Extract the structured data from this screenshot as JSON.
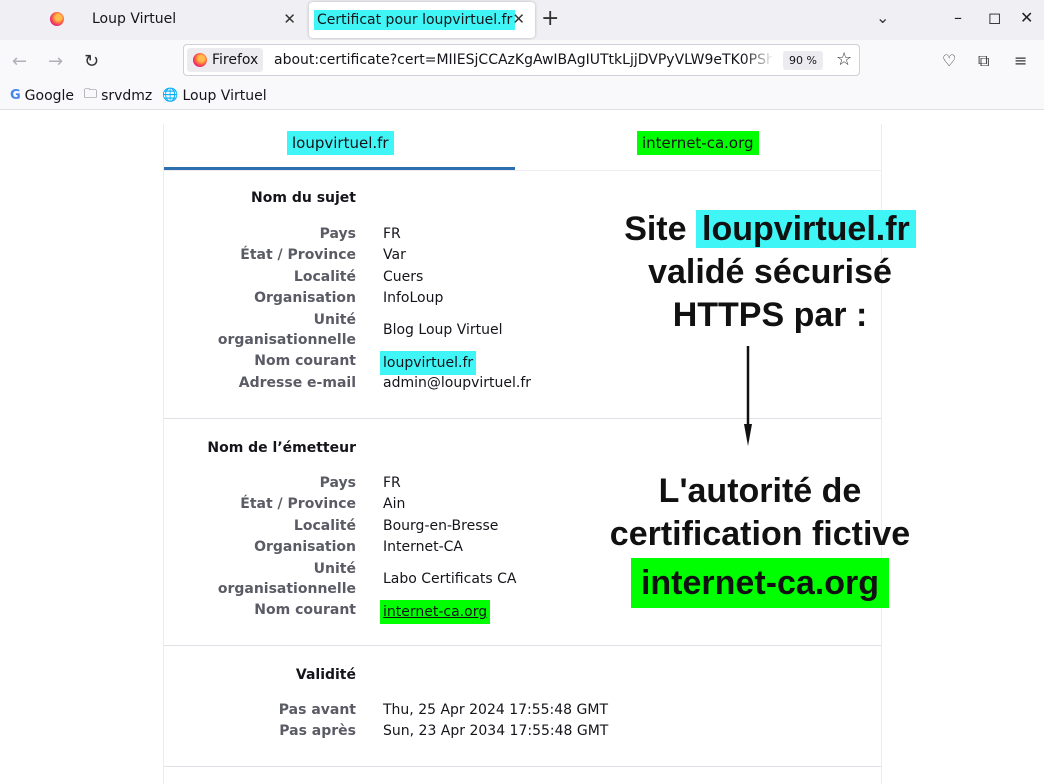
{
  "browser": {
    "tabs": [
      {
        "title": "Loup Virtuel"
      },
      {
        "title": "Certificat pour loupvirtuel.fr"
      }
    ],
    "identity_label": "Firefox",
    "url": "about:certificate?cert=MIIESjCCAzKgAwIBAgIUTtkLjjDVPyVLW9eTK0PSh",
    "zoom": "90 %",
    "bookmarks": [
      "Google",
      "srvdmz",
      "Loup Virtuel"
    ]
  },
  "certificate": {
    "tabs": [
      "loupvirtuel.fr",
      "internet-ca.org"
    ],
    "subject": {
      "heading": "Nom du sujet",
      "rows": [
        {
          "label": "Pays",
          "value": "FR"
        },
        {
          "label": "État / Province",
          "value": "Var"
        },
        {
          "label": "Localité",
          "value": "Cuers"
        },
        {
          "label": "Organisation",
          "value": "InfoLoup"
        },
        {
          "label": "Unité organisationnelle",
          "value": "Blog Loup Virtuel"
        },
        {
          "label": "Nom courant",
          "value": "loupvirtuel.fr"
        },
        {
          "label": "Adresse e-mail",
          "value": "admin@loupvirtuel.fr"
        }
      ]
    },
    "issuer": {
      "heading": "Nom de l’émetteur",
      "rows": [
        {
          "label": "Pays",
          "value": "FR"
        },
        {
          "label": "État / Province",
          "value": "Ain"
        },
        {
          "label": "Localité",
          "value": "Bourg-en-Bresse"
        },
        {
          "label": "Organisation",
          "value": "Internet-CA"
        },
        {
          "label": "Unité organisationnelle",
          "value": "Labo Certificats CA"
        },
        {
          "label": "Nom courant",
          "value": "internet-ca.org"
        }
      ]
    },
    "validity": {
      "heading": "Validité",
      "rows": [
        {
          "label": "Pas avant",
          "value": "Thu, 25 Apr 2024 17:55:48 GMT"
        },
        {
          "label": "Pas après",
          "value": "Sun, 23 Apr 2034 17:55:48 GMT"
        }
      ]
    }
  },
  "annotation": {
    "line1_prefix": "Site",
    "line1_highlight": "loupvirtuel.fr",
    "line2": "validé sécurisé",
    "line3": "HTTPS par :",
    "line4": "L'autorité de",
    "line5": "certification fictive",
    "line6": "internet-ca.org"
  },
  "colors": {
    "highlight_cyan": "#40f5f5",
    "highlight_green": "#00ff00",
    "tab_underline": "#2e6fb0"
  }
}
